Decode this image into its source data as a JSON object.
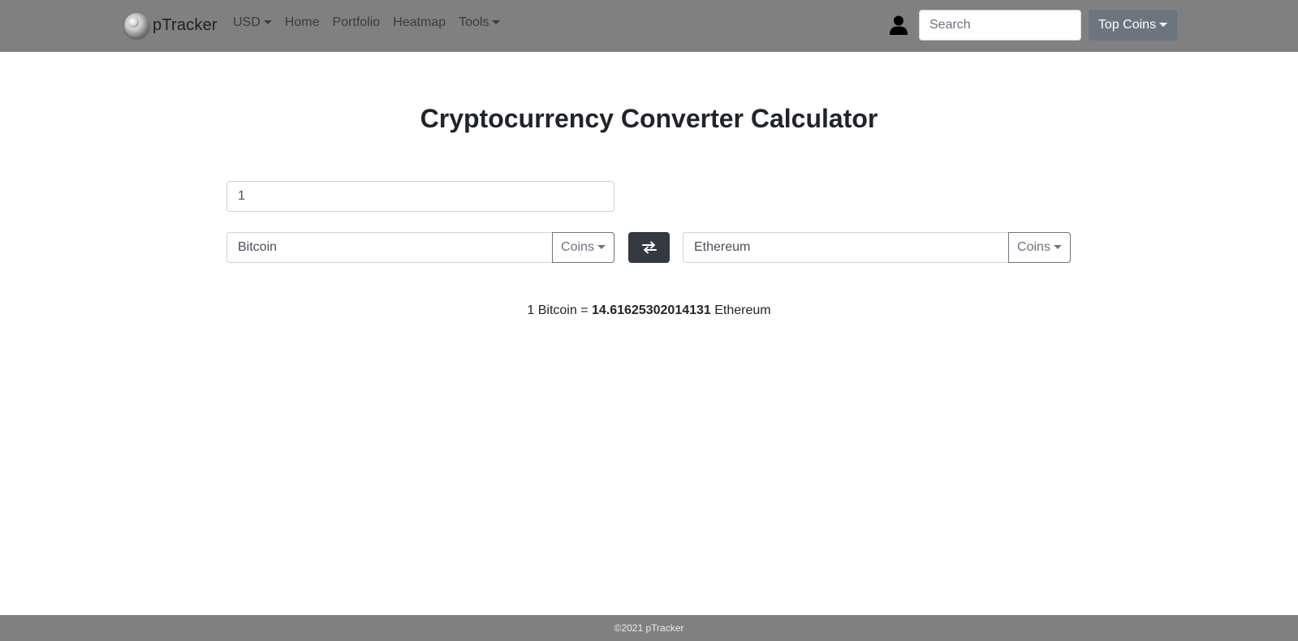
{
  "navbar": {
    "brand": "pTracker",
    "currency": "USD",
    "links": [
      "Home",
      "Portfolio",
      "Heatmap"
    ],
    "tools": "Tools",
    "search_placeholder": "Search",
    "top_coins": "Top Coins"
  },
  "main": {
    "title": "Cryptocurrency Converter Calculator",
    "amount": "1",
    "from_coin": "Bitcoin",
    "to_coin": "Ethereum",
    "coins_label": "Coins",
    "result": {
      "prefix": "1 Bitcoin = ",
      "value": "14.61625302014131",
      "suffix": " Ethereum"
    }
  },
  "footer": {
    "text": "©2021 pTracker"
  },
  "colors": {
    "navbar_bg": "#808080",
    "secondary": "#6c757d",
    "dark": "#343a40"
  },
  "icons": {
    "brand": "sphere-logo-icon",
    "user": "user-icon",
    "swap": "swap-arrows-icon"
  }
}
